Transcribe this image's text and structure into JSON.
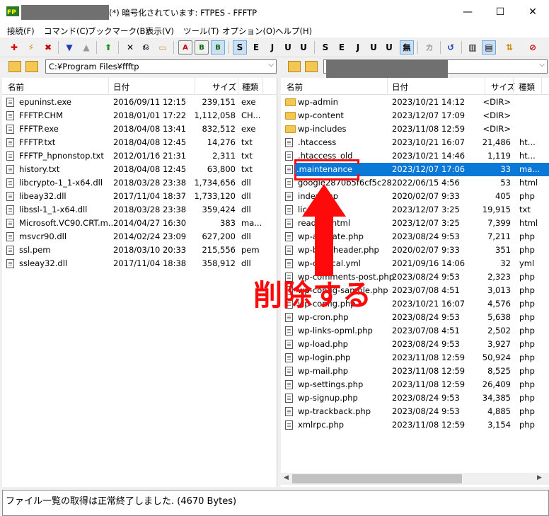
{
  "window": {
    "title": "(*) 暗号化されています: FTPES - FFFTP",
    "minimize": "—",
    "maximize": "☐",
    "close": "✕"
  },
  "menu": [
    "接続(F)",
    "コマンド(C)",
    "ブックマーク(B)",
    "表示(V)",
    "ツール(T)",
    "オプション(O)",
    "ヘルプ(H)"
  ],
  "toolbar": {
    "icons": [
      "connect-icon",
      "quick-connect-icon",
      "disconnect-icon",
      "download-icon",
      "upload-icon",
      "mirror-upload-icon",
      "delete-icon",
      "rename-icon",
      "mkdir-icon",
      "ascii-A",
      "binary-B",
      "auto-mode"
    ],
    "labels": {
      "A": "A",
      "B": "B",
      "S": "S",
      "E": "E",
      "J": "J",
      "U": "U",
      "mu": "無",
      "kana": "カ"
    }
  },
  "local": {
    "path": "C:¥Program Files¥ffftp",
    "columns": [
      "名前",
      "日付",
      "サイズ",
      "種類"
    ],
    "files": [
      {
        "name": "epuninst.exe",
        "date": "2016/09/11 12:15",
        "size": "239,151",
        "type": "exe"
      },
      {
        "name": "FFFTP.CHM",
        "date": "2018/01/01 17:22",
        "size": "1,112,058",
        "type": "CH..."
      },
      {
        "name": "FFFTP.exe",
        "date": "2018/04/08 13:41",
        "size": "832,512",
        "type": "exe"
      },
      {
        "name": "FFFTP.txt",
        "date": "2018/04/08 12:45",
        "size": "14,276",
        "type": "txt"
      },
      {
        "name": "FFFTP_hpnonstop.txt",
        "date": "2012/01/16 21:31",
        "size": "2,311",
        "type": "txt"
      },
      {
        "name": "history.txt",
        "date": "2018/04/08 12:45",
        "size": "63,800",
        "type": "txt"
      },
      {
        "name": "libcrypto-1_1-x64.dll",
        "date": "2018/03/28 23:38",
        "size": "1,734,656",
        "type": "dll"
      },
      {
        "name": "libeay32.dll",
        "date": "2017/11/04 18:37",
        "size": "1,733,120",
        "type": "dll"
      },
      {
        "name": "libssl-1_1-x64.dll",
        "date": "2018/03/28 23:38",
        "size": "359,424",
        "type": "dll"
      },
      {
        "name": "Microsoft.VC90.CRT.m...",
        "date": "2014/04/27 16:30",
        "size": "383",
        "type": "ma..."
      },
      {
        "name": "msvcr90.dll",
        "date": "2014/02/24 23:09",
        "size": "627,200",
        "type": "dll"
      },
      {
        "name": "ssl.pem",
        "date": "2018/03/10 20:33",
        "size": "215,556",
        "type": "pem"
      },
      {
        "name": "ssleay32.dll",
        "date": "2017/11/04 18:38",
        "size": "358,912",
        "type": "dll"
      }
    ]
  },
  "remote": {
    "columns": [
      "名前",
      "日付",
      "サイズ",
      "種類"
    ],
    "files": [
      {
        "name": "wp-admin",
        "date": "2023/10/21 14:12",
        "size": "<DIR>",
        "type": "",
        "folder": true
      },
      {
        "name": "wp-content",
        "date": "2023/12/07 17:09",
        "size": "<DIR>",
        "type": "",
        "folder": true
      },
      {
        "name": "wp-includes",
        "date": "2023/11/08 12:59",
        "size": "<DIR>",
        "type": "",
        "folder": true
      },
      {
        "name": ".htaccess",
        "date": "2023/10/21 16:07",
        "size": "21,486",
        "type": "ht..."
      },
      {
        "name": ".htaccess_old",
        "date": "2023/10/21 14:46",
        "size": "1,119",
        "type": "ht..."
      },
      {
        "name": ".maintenance",
        "date": "2023/12/07 17:06",
        "size": "33",
        "type": "ma...",
        "selected": true
      },
      {
        "name": "google2870b5f6cf5c28...",
        "date": "2022/06/15 4:56",
        "size": "53",
        "type": "html"
      },
      {
        "name": "index.php",
        "date": "2020/02/07 9:33",
        "size": "405",
        "type": "php"
      },
      {
        "name": "license.txt",
        "date": "2023/12/07 3:25",
        "size": "19,915",
        "type": "txt"
      },
      {
        "name": "readme.html",
        "date": "2023/12/07 3:25",
        "size": "7,399",
        "type": "html"
      },
      {
        "name": "wp-activate.php",
        "date": "2023/08/24 9:53",
        "size": "7,211",
        "type": "php"
      },
      {
        "name": "wp-blog-header.php",
        "date": "2020/02/07 9:33",
        "size": "351",
        "type": "php"
      },
      {
        "name": "wp-cli.local.yml",
        "date": "2021/09/16 14:06",
        "size": "32",
        "type": "yml"
      },
      {
        "name": "wp-comments-post.php",
        "date": "2023/08/24 9:53",
        "size": "2,323",
        "type": "php"
      },
      {
        "name": "wp-config-sample.php",
        "date": "2023/07/08 4:51",
        "size": "3,013",
        "type": "php"
      },
      {
        "name": "wp-config.php",
        "date": "2023/10/21 16:07",
        "size": "4,576",
        "type": "php"
      },
      {
        "name": "wp-cron.php",
        "date": "2023/08/24 9:53",
        "size": "5,638",
        "type": "php"
      },
      {
        "name": "wp-links-opml.php",
        "date": "2023/07/08 4:51",
        "size": "2,502",
        "type": "php"
      },
      {
        "name": "wp-load.php",
        "date": "2023/08/24 9:53",
        "size": "3,927",
        "type": "php"
      },
      {
        "name": "wp-login.php",
        "date": "2023/11/08 12:59",
        "size": "50,924",
        "type": "php"
      },
      {
        "name": "wp-mail.php",
        "date": "2023/11/08 12:59",
        "size": "8,525",
        "type": "php"
      },
      {
        "name": "wp-settings.php",
        "date": "2023/11/08 12:59",
        "size": "26,409",
        "type": "php"
      },
      {
        "name": "wp-signup.php",
        "date": "2023/08/24 9:53",
        "size": "34,385",
        "type": "php"
      },
      {
        "name": "wp-trackback.php",
        "date": "2023/08/24 9:53",
        "size": "4,885",
        "type": "php"
      },
      {
        "name": "xmlrpc.php",
        "date": "2023/11/08 12:59",
        "size": "3,154",
        "type": "php"
      }
    ]
  },
  "status": "ファイル一覧の取得は正常終了しました. (4670 Bytes)",
  "annotation": {
    "label": "削除する",
    "color": "#ff0a0a"
  }
}
